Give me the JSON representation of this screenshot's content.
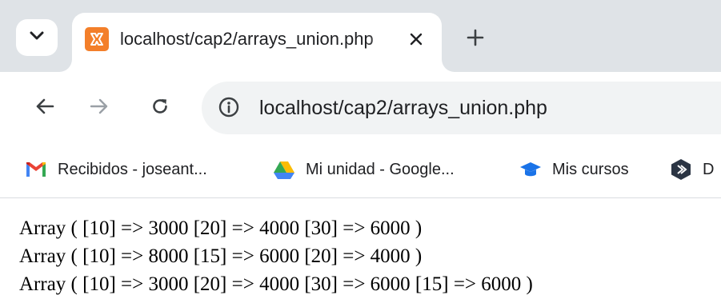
{
  "browser": {
    "active_tab": {
      "title": "localhost/cap2/arrays_union.php",
      "favicon": "xampp-icon"
    },
    "address_bar": {
      "url": "localhost/cap2/arrays_union.php"
    },
    "bookmarks": [
      {
        "label": "Recibidos - joseant...",
        "icon": "gmail-icon"
      },
      {
        "label": "Mi unidad - Google...",
        "icon": "google-drive-icon"
      },
      {
        "label": "Mis cursos",
        "icon": "graduation-cap-icon"
      },
      {
        "label": "D",
        "icon": "hexagon-logo-icon"
      }
    ],
    "colors": {
      "tabstrip_bg": "#dfe3e7",
      "omnibox_bg": "#f1f3f4",
      "favicon_orange": "#f37f2a"
    }
  },
  "page": {
    "lines": [
      "Array ( [10] => 3000 [20] => 4000 [30] => 6000 )",
      "Array ( [10] => 8000 [15] => 6000 [20] => 4000 )",
      "Array ( [10] => 3000 [20] => 4000 [30] => 6000 [15] => 6000 )"
    ]
  }
}
